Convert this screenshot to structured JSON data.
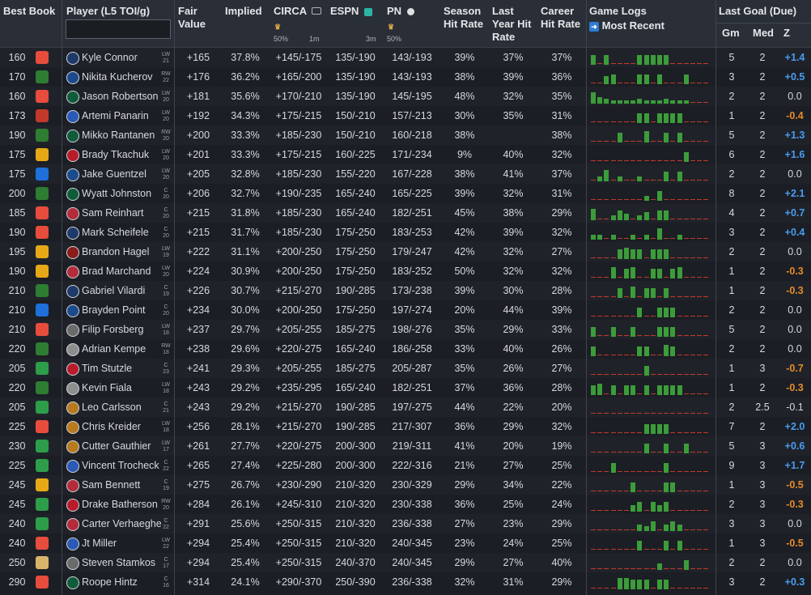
{
  "headers": {
    "best_book": "Best Book",
    "player": "Player (L5 TOI/g)",
    "fair_value": "Fair Value",
    "implied": "Implied",
    "circa": "CIRCA",
    "circa_sub1": "50%",
    "circa_sub2": "1m",
    "espn": "ESPN",
    "espn_sub": "3m",
    "pn": "PN",
    "pn_sub": "50%",
    "season_hit": "Season Hit Rate",
    "last_year_hit": "Last Year Hit Rate",
    "career_hit": "Career Hit Rate",
    "game_logs": "Game Logs",
    "most_recent": "Most Recent",
    "last_goal_due": "Last Goal (Due)",
    "gm": "Gm",
    "med": "Med",
    "z": "Z"
  },
  "rows": [
    {
      "odds": "160",
      "book": "fanduel",
      "pos": "LW",
      "toi": "21",
      "team": "wpg",
      "player": "Kyle Connor",
      "fair": "+165",
      "implied": "37.8%",
      "circa": "+145/-175",
      "espn": "135/-190",
      "pn": "143/-193",
      "season": "39%",
      "lastyear": "37%",
      "career": "37%",
      "logs": [
        12,
        0,
        12,
        0,
        0,
        0,
        0,
        12,
        12,
        12,
        12,
        12,
        0,
        0,
        0,
        0,
        0,
        0
      ],
      "gm": "5",
      "med": "2",
      "z": "+1.4",
      "zc": "pos"
    },
    {
      "odds": "170",
      "book": "betmgm",
      "pos": "RW",
      "toi": "22",
      "team": "tbl",
      "player": "Nikita Kucherov",
      "fair": "+176",
      "implied": "36.2%",
      "circa": "+165/-200",
      "espn": "135/-190",
      "pn": "143/-193",
      "season": "38%",
      "lastyear": "39%",
      "career": "36%",
      "logs": [
        0,
        0,
        10,
        12,
        0,
        0,
        0,
        12,
        12,
        0,
        12,
        0,
        0,
        0,
        12,
        0,
        0,
        0
      ],
      "gm": "3",
      "med": "2",
      "z": "+0.5",
      "zc": "pos"
    },
    {
      "odds": "160",
      "book": "fanduel",
      "pos": "LW",
      "toi": "20",
      "team": "dal",
      "player": "Jason Robertson",
      "fair": "+181",
      "implied": "35.6%",
      "circa": "+170/-210",
      "espn": "135/-190",
      "pn": "145/-195",
      "season": "48%",
      "lastyear": "32%",
      "career": "35%",
      "logs": [
        14,
        8,
        6,
        4,
        4,
        4,
        4,
        6,
        4,
        4,
        4,
        6,
        4,
        4,
        4,
        0,
        0,
        0
      ],
      "gm": "2",
      "med": "2",
      "z": "0.0",
      "zc": "neutral"
    },
    {
      "odds": "173",
      "book": "bet365",
      "pos": "LW",
      "toi": "20",
      "team": "nyr",
      "player": "Artemi Panarin",
      "fair": "+192",
      "implied": "34.3%",
      "circa": "+175/-215",
      "espn": "150/-210",
      "pn": "157/-213",
      "season": "30%",
      "lastyear": "35%",
      "career": "31%",
      "logs": [
        0,
        0,
        0,
        0,
        0,
        0,
        0,
        12,
        12,
        0,
        12,
        12,
        12,
        12,
        0,
        0,
        0,
        0
      ],
      "gm": "1",
      "med": "2",
      "z": "-0.4",
      "zc": "neg"
    },
    {
      "odds": "190",
      "book": "betmgm",
      "pos": "RW",
      "toi": "20",
      "team": "dal",
      "player": "Mikko Rantanen",
      "fair": "+200",
      "implied": "33.3%",
      "circa": "+185/-230",
      "espn": "150/-210",
      "pn": "160/-218",
      "season": "38%",
      "lastyear": "",
      "career": "38%",
      "logs": [
        0,
        0,
        0,
        0,
        12,
        0,
        0,
        0,
        14,
        0,
        0,
        12,
        0,
        12,
        0,
        0,
        0,
        0
      ],
      "gm": "5",
      "med": "2",
      "z": "+1.3",
      "zc": "pos"
    },
    {
      "odds": "175",
      "book": "caesars",
      "pos": "LW",
      "toi": "20",
      "team": "ott",
      "player": "Brady Tkachuk",
      "fair": "+201",
      "implied": "33.3%",
      "circa": "+175/-215",
      "espn": "160/-225",
      "pn": "171/-234",
      "season": "9%",
      "lastyear": "40%",
      "career": "32%",
      "logs": [
        0,
        0,
        0,
        0,
        0,
        0,
        0,
        0,
        0,
        0,
        0,
        0,
        0,
        0,
        12,
        0,
        0,
        0
      ],
      "gm": "6",
      "med": "2",
      "z": "+1.6",
      "zc": "pos"
    },
    {
      "odds": "175",
      "book": "fanatics",
      "pos": "LW",
      "toi": "20",
      "team": "tbl",
      "player": "Jake Guentzel",
      "fair": "+205",
      "implied": "32.8%",
      "circa": "+185/-230",
      "espn": "155/-220",
      "pn": "167/-228",
      "season": "38%",
      "lastyear": "41%",
      "career": "37%",
      "logs": [
        0,
        6,
        14,
        0,
        6,
        0,
        0,
        6,
        0,
        0,
        0,
        12,
        0,
        12,
        0,
        0,
        0,
        0
      ],
      "gm": "2",
      "med": "2",
      "z": "0.0",
      "zc": "neutral"
    },
    {
      "odds": "200",
      "book": "betmgm",
      "pos": "C",
      "toi": "20",
      "team": "dal",
      "player": "Wyatt Johnston",
      "fair": "+206",
      "implied": "32.7%",
      "circa": "+190/-235",
      "espn": "165/-240",
      "pn": "165/-225",
      "season": "39%",
      "lastyear": "32%",
      "career": "31%",
      "logs": [
        0,
        0,
        0,
        0,
        0,
        0,
        0,
        0,
        6,
        0,
        12,
        0,
        0,
        0,
        0,
        0,
        0,
        0
      ],
      "gm": "8",
      "med": "2",
      "z": "+2.1",
      "zc": "pos"
    },
    {
      "odds": "185",
      "book": "fanduel",
      "pos": "C",
      "toi": "20",
      "team": "fla",
      "player": "Sam Reinhart",
      "fair": "+215",
      "implied": "31.8%",
      "circa": "+185/-230",
      "espn": "165/-240",
      "pn": "182/-251",
      "season": "45%",
      "lastyear": "38%",
      "career": "29%",
      "logs": [
        14,
        0,
        0,
        6,
        12,
        8,
        0,
        6,
        10,
        0,
        12,
        12,
        0,
        0,
        0,
        0,
        0,
        0
      ],
      "gm": "4",
      "med": "2",
      "z": "+0.7",
      "zc": "pos"
    },
    {
      "odds": "190",
      "book": "fanduel",
      "pos": "C",
      "toi": "20",
      "team": "wpg",
      "player": "Mark Scheifele",
      "fair": "+215",
      "implied": "31.7%",
      "circa": "+185/-230",
      "espn": "175/-250",
      "pn": "183/-253",
      "season": "42%",
      "lastyear": "39%",
      "career": "32%",
      "logs": [
        6,
        6,
        0,
        6,
        0,
        0,
        6,
        0,
        6,
        0,
        14,
        0,
        0,
        6,
        0,
        0,
        0,
        0
      ],
      "gm": "3",
      "med": "2",
      "z": "+0.4",
      "zc": "pos"
    },
    {
      "odds": "195",
      "book": "caesars",
      "pos": "LW",
      "toi": "19",
      "team": "chi",
      "player": "Brandon Hagel",
      "fair": "+222",
      "implied": "31.1%",
      "circa": "+200/-250",
      "espn": "175/-250",
      "pn": "179/-247",
      "season": "42%",
      "lastyear": "32%",
      "career": "27%",
      "logs": [
        0,
        0,
        0,
        0,
        12,
        14,
        12,
        12,
        0,
        12,
        12,
        12,
        0,
        0,
        0,
        0,
        0,
        0
      ],
      "gm": "2",
      "med": "2",
      "z": "0.0",
      "zc": "neutral"
    },
    {
      "odds": "190",
      "book": "caesars",
      "pos": "LW",
      "toi": "20",
      "team": "fla",
      "player": "Brad Marchand",
      "fair": "+224",
      "implied": "30.9%",
      "circa": "+200/-250",
      "espn": "175/-250",
      "pn": "183/-252",
      "season": "50%",
      "lastyear": "32%",
      "career": "32%",
      "logs": [
        0,
        0,
        0,
        14,
        0,
        12,
        14,
        0,
        0,
        12,
        12,
        0,
        12,
        14,
        0,
        0,
        0,
        0
      ],
      "gm": "1",
      "med": "2",
      "z": "-0.3",
      "zc": "neg"
    },
    {
      "odds": "210",
      "book": "betmgm",
      "pos": "C",
      "toi": "19",
      "team": "wpg",
      "player": "Gabriel Vilardi",
      "fair": "+226",
      "implied": "30.7%",
      "circa": "+215/-270",
      "espn": "190/-285",
      "pn": "173/-238",
      "season": "39%",
      "lastyear": "30%",
      "career": "28%",
      "logs": [
        0,
        0,
        0,
        0,
        12,
        0,
        14,
        0,
        12,
        12,
        0,
        12,
        0,
        0,
        0,
        0,
        0,
        0
      ],
      "gm": "1",
      "med": "2",
      "z": "-0.3",
      "zc": "neg"
    },
    {
      "odds": "210",
      "book": "fanatics",
      "pos": "C",
      "toi": "20",
      "team": "tbl",
      "player": "Brayden Point",
      "fair": "+234",
      "implied": "30.0%",
      "circa": "+200/-250",
      "espn": "175/-250",
      "pn": "197/-274",
      "season": "20%",
      "lastyear": "44%",
      "career": "39%",
      "logs": [
        0,
        0,
        0,
        0,
        0,
        0,
        0,
        12,
        0,
        0,
        12,
        12,
        12,
        0,
        0,
        0,
        0,
        0
      ],
      "gm": "2",
      "med": "2",
      "z": "0.0",
      "zc": "neutral"
    },
    {
      "odds": "210",
      "book": "fanduel",
      "pos": "LW",
      "toi": "18",
      "team": "nsh",
      "player": "Filip Forsberg",
      "fair": "+237",
      "implied": "29.7%",
      "circa": "+205/-255",
      "espn": "185/-275",
      "pn": "198/-276",
      "season": "35%",
      "lastyear": "29%",
      "career": "33%",
      "logs": [
        12,
        0,
        0,
        12,
        0,
        0,
        12,
        0,
        0,
        0,
        12,
        12,
        12,
        0,
        0,
        0,
        0,
        0
      ],
      "gm": "5",
      "med": "2",
      "z": "0.0",
      "zc": "neutral"
    },
    {
      "odds": "220",
      "book": "betmgm",
      "pos": "RW",
      "toi": "18",
      "team": "lak",
      "player": "Adrian Kempe",
      "fair": "+238",
      "implied": "29.6%",
      "circa": "+220/-275",
      "espn": "165/-240",
      "pn": "186/-258",
      "season": "33%",
      "lastyear": "40%",
      "career": "26%",
      "logs": [
        12,
        0,
        0,
        0,
        0,
        0,
        0,
        12,
        12,
        0,
        0,
        14,
        12,
        0,
        0,
        0,
        0,
        0
      ],
      "gm": "2",
      "med": "2",
      "z": "0.0",
      "zc": "neutral"
    },
    {
      "odds": "205",
      "book": "draftkings",
      "pos": "C",
      "toi": "23",
      "team": "ott",
      "player": "Tim Stutzle",
      "fair": "+241",
      "implied": "29.3%",
      "circa": "+205/-255",
      "espn": "185/-275",
      "pn": "205/-287",
      "season": "35%",
      "lastyear": "26%",
      "career": "27%",
      "logs": [
        0,
        0,
        0,
        0,
        0,
        0,
        0,
        0,
        12,
        0,
        0,
        0,
        0,
        0,
        0,
        0,
        0,
        0
      ],
      "gm": "1",
      "med": "3",
      "z": "-0.7",
      "zc": "neg"
    },
    {
      "odds": "220",
      "book": "betmgm",
      "pos": "LW",
      "toi": "18",
      "team": "lak",
      "player": "Kevin Fiala",
      "fair": "+243",
      "implied": "29.2%",
      "circa": "+235/-295",
      "espn": "165/-240",
      "pn": "182/-251",
      "season": "37%",
      "lastyear": "36%",
      "career": "28%",
      "logs": [
        12,
        14,
        0,
        12,
        0,
        12,
        12,
        0,
        12,
        0,
        12,
        12,
        12,
        12,
        0,
        0,
        0,
        0
      ],
      "gm": "1",
      "med": "2",
      "z": "-0.3",
      "zc": "neg"
    },
    {
      "odds": "205",
      "book": "draftkings",
      "pos": "C",
      "toi": "21",
      "team": "ana",
      "player": "Leo Carlsson",
      "fair": "+243",
      "implied": "29.2%",
      "circa": "+215/-270",
      "espn": "190/-285",
      "pn": "197/-275",
      "season": "44%",
      "lastyear": "22%",
      "career": "20%",
      "logs": [
        0,
        0,
        0,
        0,
        0,
        0,
        0,
        0,
        0,
        0,
        0,
        0,
        0,
        0,
        0,
        0,
        0,
        0
      ],
      "gm": "2",
      "med": "2.5",
      "z": "-0.1",
      "zc": "neutral"
    },
    {
      "odds": "225",
      "book": "fanduel",
      "pos": "LW",
      "toi": "18",
      "team": "ana",
      "player": "Chris Kreider",
      "fair": "+256",
      "implied": "28.1%",
      "circa": "+215/-270",
      "espn": "190/-285",
      "pn": "217/-307",
      "season": "36%",
      "lastyear": "29%",
      "career": "32%",
      "logs": [
        0,
        0,
        0,
        0,
        0,
        0,
        0,
        0,
        12,
        12,
        12,
        12,
        0,
        0,
        0,
        0,
        0,
        0
      ],
      "gm": "7",
      "med": "2",
      "z": "+2.0",
      "zc": "pos"
    },
    {
      "odds": "230",
      "book": "draftkings",
      "pos": "LW",
      "toi": "17",
      "team": "ana",
      "player": "Cutter Gauthier",
      "fair": "+261",
      "implied": "27.7%",
      "circa": "+220/-275",
      "espn": "200/-300",
      "pn": "219/-311",
      "season": "41%",
      "lastyear": "20%",
      "career": "19%",
      "logs": [
        0,
        0,
        0,
        0,
        0,
        0,
        0,
        0,
        12,
        0,
        0,
        12,
        0,
        0,
        12,
        0,
        0,
        0
      ],
      "gm": "5",
      "med": "3",
      "z": "+0.6",
      "zc": "pos"
    },
    {
      "odds": "225",
      "book": "draftkings",
      "pos": "C",
      "toi": "22",
      "team": "nyr",
      "player": "Vincent Trocheck",
      "fair": "+265",
      "implied": "27.4%",
      "circa": "+225/-280",
      "espn": "200/-300",
      "pn": "222/-316",
      "season": "21%",
      "lastyear": "27%",
      "career": "25%",
      "logs": [
        0,
        0,
        0,
        12,
        0,
        0,
        0,
        0,
        0,
        0,
        0,
        12,
        0,
        0,
        0,
        0,
        0,
        0
      ],
      "gm": "9",
      "med": "3",
      "z": "+1.7",
      "zc": "pos"
    },
    {
      "odds": "245",
      "book": "caesars",
      "pos": "C",
      "toi": "19",
      "team": "fla",
      "player": "Sam Bennett",
      "fair": "+275",
      "implied": "26.7%",
      "circa": "+230/-290",
      "espn": "210/-320",
      "pn": "230/-329",
      "season": "29%",
      "lastyear": "34%",
      "career": "22%",
      "logs": [
        0,
        0,
        0,
        0,
        0,
        0,
        12,
        0,
        0,
        0,
        0,
        12,
        12,
        0,
        0,
        0,
        0,
        0
      ],
      "gm": "1",
      "med": "3",
      "z": "-0.5",
      "zc": "neg"
    },
    {
      "odds": "245",
      "book": "draftkings",
      "pos": "RW",
      "toi": "20",
      "team": "ott",
      "player": "Drake Batherson",
      "fair": "+284",
      "implied": "26.1%",
      "circa": "+245/-310",
      "espn": "210/-320",
      "pn": "230/-338",
      "season": "36%",
      "lastyear": "25%",
      "career": "24%",
      "logs": [
        0,
        0,
        0,
        0,
        0,
        0,
        8,
        12,
        0,
        12,
        8,
        12,
        0,
        0,
        0,
        0,
        0,
        0
      ],
      "gm": "2",
      "med": "3",
      "z": "-0.3",
      "zc": "neg"
    },
    {
      "odds": "240",
      "book": "draftkings",
      "pos": "C",
      "toi": "22",
      "team": "fla",
      "player": "Carter Verhaeghe",
      "fair": "+291",
      "implied": "25.6%",
      "circa": "+250/-315",
      "espn": "210/-320",
      "pn": "236/-338",
      "season": "27%",
      "lastyear": "23%",
      "career": "29%",
      "logs": [
        0,
        0,
        0,
        0,
        0,
        0,
        0,
        8,
        6,
        12,
        0,
        8,
        12,
        8,
        0,
        0,
        0,
        0
      ],
      "gm": "3",
      "med": "3",
      "z": "0.0",
      "zc": "neutral"
    },
    {
      "odds": "240",
      "book": "fanduel",
      "pos": "LW",
      "toi": "22",
      "team": "nyr",
      "player": "Jt Miller",
      "fair": "+294",
      "implied": "25.4%",
      "circa": "+250/-315",
      "espn": "210/-320",
      "pn": "240/-345",
      "season": "23%",
      "lastyear": "24%",
      "career": "25%",
      "logs": [
        0,
        0,
        0,
        0,
        0,
        0,
        0,
        12,
        0,
        0,
        0,
        12,
        0,
        12,
        0,
        0,
        0,
        0
      ],
      "gm": "1",
      "med": "3",
      "z": "-0.5",
      "zc": "neg"
    },
    {
      "odds": "250",
      "book": "espnbet",
      "pos": "C",
      "toi": "17",
      "team": "nsh",
      "player": "Steven Stamkos",
      "fair": "+294",
      "implied": "25.4%",
      "circa": "+250/-315",
      "espn": "240/-370",
      "pn": "240/-345",
      "season": "29%",
      "lastyear": "27%",
      "career": "40%",
      "logs": [
        0,
        0,
        0,
        0,
        0,
        0,
        0,
        0,
        0,
        0,
        8,
        0,
        0,
        0,
        12,
        0,
        0,
        0
      ],
      "gm": "2",
      "med": "2",
      "z": "0.0",
      "zc": "neutral"
    },
    {
      "odds": "290",
      "book": "fanduel",
      "pos": "C",
      "toi": "16",
      "team": "dal",
      "player": "Roope Hintz",
      "fair": "+314",
      "implied": "24.1%",
      "circa": "+290/-370",
      "espn": "250/-390",
      "pn": "236/-338",
      "season": "32%",
      "lastyear": "31%",
      "career": "29%",
      "logs": [
        0,
        0,
        0,
        0,
        14,
        14,
        12,
        12,
        12,
        0,
        12,
        12,
        0,
        0,
        0,
        0,
        0,
        0
      ],
      "gm": "3",
      "med": "2",
      "z": "+0.3",
      "zc": "pos"
    }
  ],
  "colors": {
    "fanduel": "#e74c3c",
    "betmgm": "#2e7d32",
    "bet365": "#c0392b",
    "caesars": "#e6a817",
    "fanatics": "#1e6fd9",
    "draftkings": "#2e9d4a",
    "espnbet": "#d8b46a",
    "wpg": "#1d3a6b",
    "tbl": "#1b4b8c",
    "dal": "#0f5c3a",
    "nyr": "#2a5ab5",
    "ott": "#b81c2b",
    "fla": "#b52b3b",
    "chi": "#8a1c1c",
    "nsh": "#6b6b6b",
    "lak": "#8e8e8e",
    "ana": "#b87a1c"
  },
  "icons": {
    "circa": "crown-icon",
    "espn": "espn-icon",
    "pn": "pinnacle-icon",
    "most_recent": "arrow-right-icon"
  }
}
